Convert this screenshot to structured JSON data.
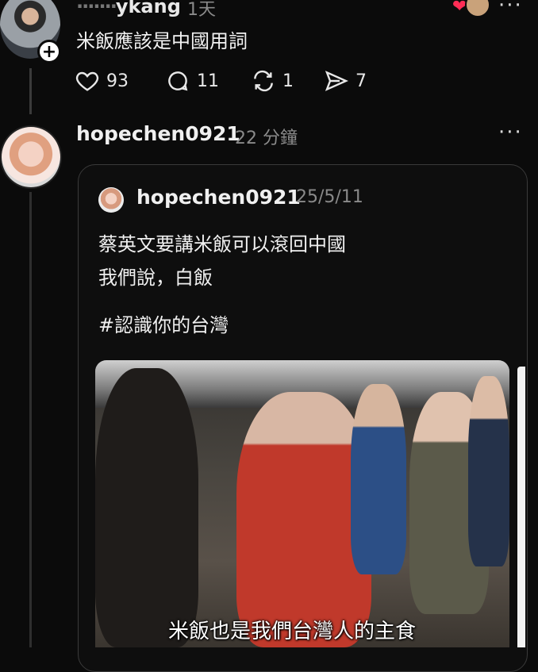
{
  "top_post": {
    "username_blurred": "·······",
    "username": "ykang",
    "time": "1天",
    "text": "米飯應該是中國用詞",
    "follow_symbol": "+",
    "actions": {
      "likes": "93",
      "comments": "11",
      "reposts": "1",
      "shares": "7"
    },
    "more": "···"
  },
  "reply": {
    "username": "hopechen0921",
    "time": "22 分鐘",
    "more": "···",
    "quote": {
      "username": "hopechen0921",
      "date": "25/5/11",
      "line1": "蔡英文要講米飯可以滾回中國",
      "line2": "我們說，白飯",
      "hashtag": "#認識你的台灣",
      "image_subtitle": "米飯也是我們台灣人的主食"
    }
  },
  "colors": {
    "background": "#0b0b0b",
    "heart": "#ff2d55",
    "muted": "#8a8a8a"
  }
}
